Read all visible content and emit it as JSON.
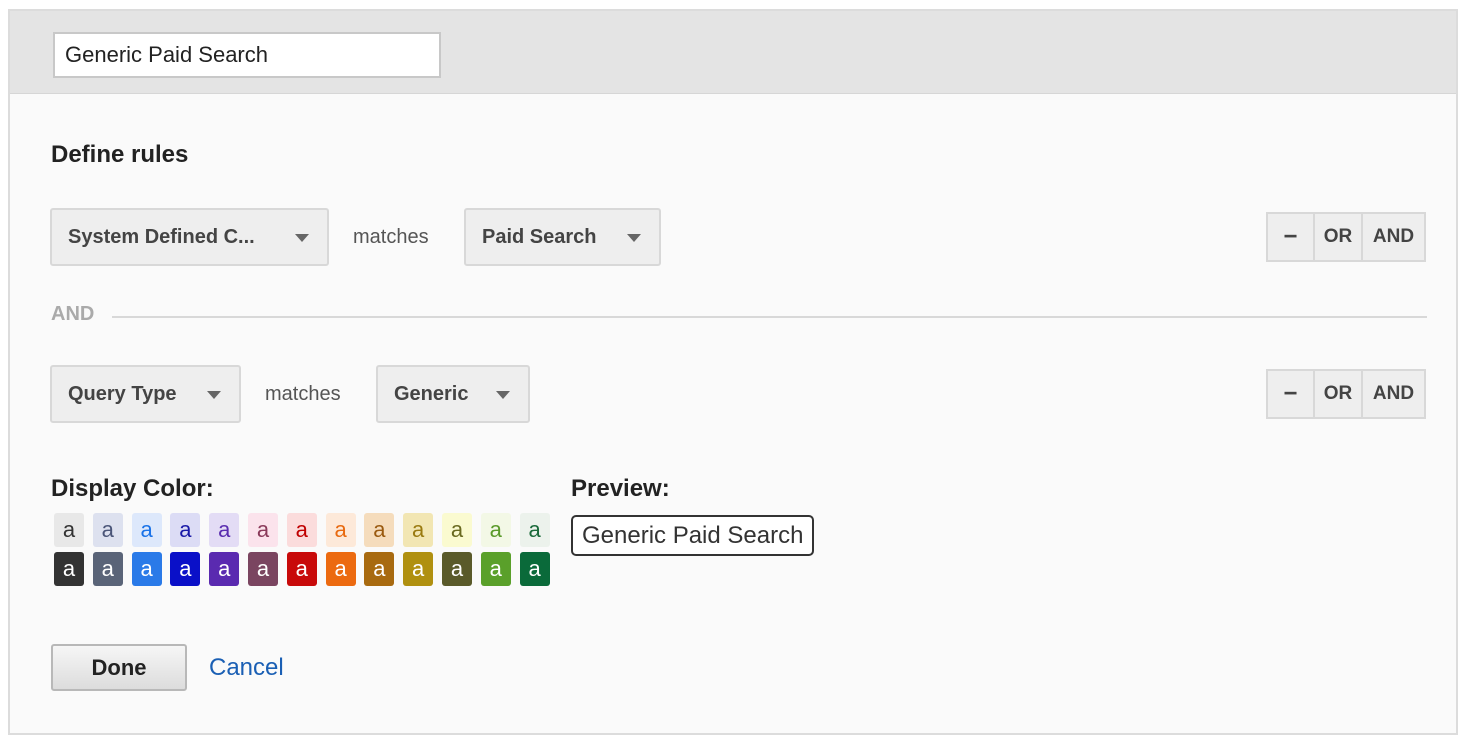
{
  "segment_name": "Generic Paid Search",
  "define_rules_title": "Define rules",
  "rules": [
    {
      "dimension": "System Defined C...",
      "operator": "matches",
      "value": "Paid Search",
      "buttons": {
        "minus": "−",
        "or": "OR",
        "and": "AND"
      }
    },
    {
      "dimension": "Query Type",
      "operator": "matches",
      "value": "Generic",
      "buttons": {
        "minus": "−",
        "or": "OR",
        "and": "AND"
      }
    }
  ],
  "rule_separator": "AND",
  "display_color_label": "Display Color:",
  "preview_label": "Preview:",
  "preview_text": "Generic Paid Search",
  "swatch_letter": "a",
  "swatches": {
    "light": [
      {
        "bg": "#e8e8e8",
        "fg": "#333333"
      },
      {
        "bg": "#dde1ef",
        "fg": "#4a5578"
      },
      {
        "bg": "#dde8fb",
        "fg": "#1a73e8"
      },
      {
        "bg": "#dcdcf5",
        "fg": "#1a1aa8"
      },
      {
        "bg": "#e3dcf5",
        "fg": "#5a2db0"
      },
      {
        "bg": "#fbe3ec",
        "fg": "#8a3a5a"
      },
      {
        "bg": "#fbdcdc",
        "fg": "#c00000"
      },
      {
        "bg": "#fde9d9",
        "fg": "#e86a10"
      },
      {
        "bg": "#f5dcbc",
        "fg": "#9a5a10"
      },
      {
        "bg": "#f2e6b3",
        "fg": "#9a7a10"
      },
      {
        "bg": "#fafad0",
        "fg": "#6a6a20"
      },
      {
        "bg": "#f3f8e6",
        "fg": "#5a9a2a"
      },
      {
        "bg": "#ecf2ec",
        "fg": "#1a6a3a"
      }
    ],
    "dark": [
      {
        "bg": "#333333",
        "fg": "#ffffff"
      },
      {
        "bg": "#5a6478",
        "fg": "#ffffff"
      },
      {
        "bg": "#2a7ae8",
        "fg": "#ffffff"
      },
      {
        "bg": "#0a10c8",
        "fg": "#ffffff"
      },
      {
        "bg": "#5a2ab0",
        "fg": "#ffffff"
      },
      {
        "bg": "#7a4560",
        "fg": "#ffffff"
      },
      {
        "bg": "#c80a0a",
        "fg": "#ffffff"
      },
      {
        "bg": "#ec6a10",
        "fg": "#ffffff"
      },
      {
        "bg": "#a86a10",
        "fg": "#ffffff"
      },
      {
        "bg": "#b09010",
        "fg": "#ffffff"
      },
      {
        "bg": "#5a5a2a",
        "fg": "#ffffff"
      },
      {
        "bg": "#5aa02a",
        "fg": "#ffffff"
      },
      {
        "bg": "#0a6a3a",
        "fg": "#ffffff"
      }
    ]
  },
  "done_label": "Done",
  "cancel_label": "Cancel"
}
